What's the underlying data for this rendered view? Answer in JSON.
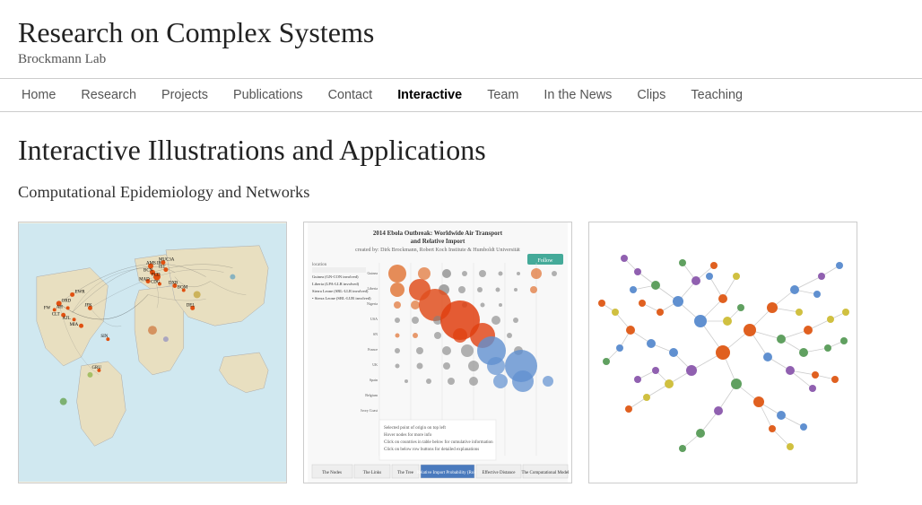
{
  "site": {
    "title": "Research on Complex Systems",
    "subtitle": "Brockmann Lab"
  },
  "nav": {
    "items": [
      {
        "label": "Home",
        "href": "#",
        "active": false
      },
      {
        "label": "Research",
        "href": "#",
        "active": false
      },
      {
        "label": "Projects",
        "href": "#",
        "active": false
      },
      {
        "label": "Publications",
        "href": "#",
        "active": false
      },
      {
        "label": "Contact",
        "href": "#",
        "active": false
      },
      {
        "label": "Interactive",
        "href": "#",
        "active": true
      },
      {
        "label": "Team",
        "href": "#",
        "active": false
      },
      {
        "label": "In the News",
        "href": "#",
        "active": false
      },
      {
        "label": "Clips",
        "href": "#",
        "active": false
      },
      {
        "label": "Teaching",
        "href": "#",
        "active": false
      }
    ]
  },
  "page": {
    "title": "Interactive Illustrations and Applications",
    "section": "Computational Epidemiology and Networks"
  },
  "gallery": {
    "items": [
      {
        "label": "World Air Transport Map",
        "type": "map"
      },
      {
        "label": "2014 Ebola Outbreak: Worldwide Air Transport and Relative Import",
        "type": "ebola"
      },
      {
        "label": "Network Visualization",
        "type": "network"
      }
    ]
  }
}
